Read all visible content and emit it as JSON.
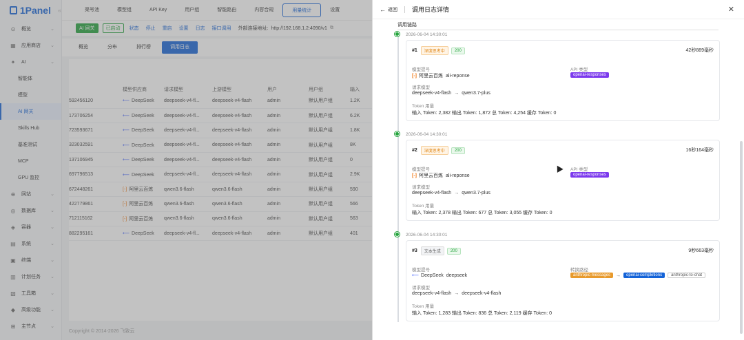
{
  "brand": {
    "name": "1Panel",
    "fold_icon": "double-chevron-left-icon"
  },
  "sidebar": {
    "items": [
      {
        "label": "概览",
        "icon": "dashboard-icon",
        "glyph": "⊙"
      },
      {
        "label": "应用商店",
        "icon": "appstore-icon",
        "glyph": "▦"
      },
      {
        "label": "AI",
        "icon": "ai-icon",
        "glyph": "✦",
        "expanded": true
      },
      {
        "label": "网站",
        "icon": "globe-icon",
        "glyph": "⊕"
      },
      {
        "label": "数据库",
        "icon": "database-icon",
        "glyph": "◎"
      },
      {
        "label": "容器",
        "icon": "container-icon",
        "glyph": "◈"
      },
      {
        "label": "系统",
        "icon": "system-icon",
        "glyph": "▤"
      },
      {
        "label": "终端",
        "icon": "terminal-icon",
        "glyph": "▣"
      },
      {
        "label": "计划任务",
        "icon": "cron-icon",
        "glyph": "▥"
      },
      {
        "label": "工具箱",
        "icon": "toolbox-icon",
        "glyph": "▧"
      },
      {
        "label": "高级功能",
        "icon": "diamond-icon",
        "glyph": "◆"
      },
      {
        "label": "主节点",
        "icon": "node-icon",
        "glyph": "⊞"
      }
    ],
    "ai_subitems": [
      "智能体",
      "模型",
      "AI 网关",
      "Skills Hub",
      "基准测试",
      "MCP",
      "GPU 监控"
    ],
    "active_subitem": "AI 网关"
  },
  "topbar": {
    "tabs": [
      "渠号池",
      "模型组",
      "API Key",
      "用户组",
      "智能路由",
      "内容合规",
      "用量统计",
      "设置"
    ],
    "active_tab": "用量统计"
  },
  "statusbar": {
    "badge": "AI 网关",
    "state": "已启动",
    "actions": [
      "状态",
      "停止",
      "重启",
      "设置",
      "日志",
      "接口调用"
    ],
    "address_label": "外部连接地址:",
    "address": "http://192.168.1.2:4090/v1"
  },
  "subtabs": {
    "items": [
      "概览",
      "分布",
      "排行榜",
      "调用日志"
    ],
    "active": "调用日志"
  },
  "table": {
    "headers": [
      "",
      "模型供应商",
      "请求模型",
      "上游模型",
      "用户",
      "用户组",
      "输入"
    ],
    "rows": [
      [
        "592456120",
        "DeepSeek",
        "deepseek-v4-fl...",
        "deepseek-v4-flash",
        "admin",
        "默认用户组",
        "1.2K"
      ],
      [
        "173706254",
        "DeepSeek",
        "deepseek-v4-fl...",
        "deepseek-v4-flash",
        "admin",
        "默认用户组",
        "6.2K"
      ],
      [
        "723593671",
        "DeepSeek",
        "deepseek-v4-fl...",
        "deepseek-v4-flash",
        "admin",
        "默认用户组",
        "1.8K"
      ],
      [
        "323032591",
        "DeepSeek",
        "deepseek-v4-fl...",
        "deepseek-v4-flash",
        "admin",
        "默认用户组",
        "8K"
      ],
      [
        "137106945",
        "DeepSeek",
        "deepseek-v4-fl...",
        "deepseek-v4-flash",
        "admin",
        "默认用户组",
        "0"
      ],
      [
        "697796513",
        "DeepSeek",
        "deepseek-v4-fl...",
        "deepseek-v4-flash",
        "admin",
        "默认用户组",
        "2.9K"
      ],
      [
        "672448261",
        "阿里云百炼",
        "qwen3.6-flash",
        "qwen3.6-flash",
        "admin",
        "默认用户组",
        "590"
      ],
      [
        "422779861",
        "阿里云百炼",
        "qwen3.6-flash",
        "qwen3.6-flash",
        "admin",
        "默认用户组",
        "566"
      ],
      [
        "712115162",
        "阿里云百炼",
        "qwen3.6-flash",
        "qwen3.6-flash",
        "admin",
        "默认用户组",
        "563"
      ],
      [
        "882295161",
        "DeepSeek",
        "deepseek-v4-fl...",
        "deepseek-v4-flash",
        "admin",
        "默认用户组",
        "401"
      ]
    ]
  },
  "footer": {
    "copyright": "Copyright © 2014-2026 飞致云"
  },
  "drawer": {
    "back_label": "返回",
    "title": "调用日志详情",
    "chain_label": "调用链路",
    "entries": [
      {
        "time": "2026-06-04 14:30:01",
        "index": "#1",
        "tag": "深度思考中",
        "status": "200",
        "duration": "42秒889毫秒",
        "model_label": "模型提号",
        "provider": "阿里云百炼",
        "model": "ali-reponse",
        "right_label": "API 类型",
        "api_type": "openai-responses",
        "req_label": "请求模型",
        "req_from": "deepseek-v4-flash",
        "req_to": "qwen3.7-plus",
        "token_label": "Token 用量",
        "token_line": "输入 Token: 2,382  输出 Token: 1,872  总 Token: 4,254  缓存 Token: 0"
      },
      {
        "time": "2026-06-04 14:30:01",
        "index": "#2",
        "tag": "深度思考中",
        "status": "200",
        "duration": "16秒164毫秒",
        "model_label": "模型提号",
        "provider": "阿里云百炼",
        "model": "ali-reponse",
        "right_label": "API 类型",
        "api_type": "openai-responses",
        "req_label": "请求模型",
        "req_from": "deepseek-v4-flash",
        "req_to": "qwen3.7-plus",
        "token_label": "Token 用量",
        "token_line": "输入 Token: 2,378  输出 Token: 677  总 Token: 3,055  缓存 Token: 0"
      },
      {
        "time": "2026-06-04 14:30:01",
        "index": "#3",
        "tag": "文本生成",
        "status": "200",
        "duration": "9秒663毫秒",
        "model_label": "模型提号",
        "provider": "DeepSeek",
        "model": "deepseek",
        "right_label": "转换路径",
        "path": [
          "anthropic-messages",
          "openai-completions",
          "anthropic-to-chat"
        ],
        "req_label": "请求模型",
        "req_from": "deepseek-v4-flash",
        "req_to": "deepseek-v4-flash",
        "token_label": "Token 用量",
        "token_line": "输入 Token: 1,283  输出 Token: 836  总 Token: 2,119  缓存 Token: 0"
      }
    ]
  },
  "colors": {
    "primary": "#1463d8",
    "success": "#22a33b",
    "purple": "#7c3aed",
    "orange": "#e89a2c"
  }
}
